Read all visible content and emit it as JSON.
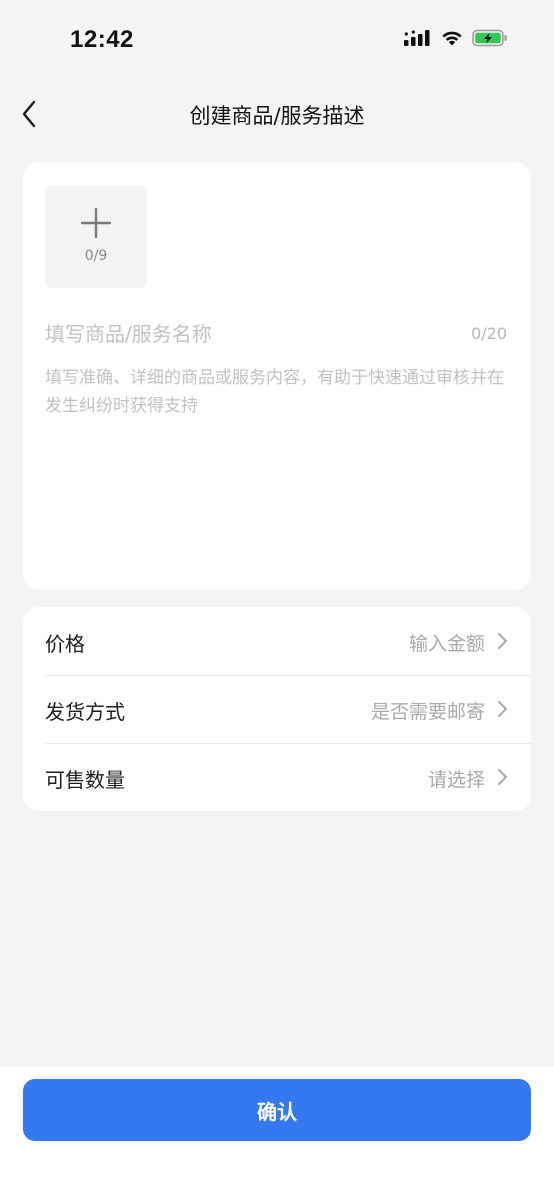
{
  "status_bar": {
    "time": "12:42"
  },
  "nav": {
    "title": "创建商品/服务描述"
  },
  "description_card": {
    "upload_count": "0/9",
    "name_placeholder": "填写商品/服务名称",
    "name_counter": "0/20",
    "desc_placeholder": "填写准确、详细的商品或服务内容，有助于快速通过审核并在发生纠纷时获得支持"
  },
  "options": [
    {
      "label": "价格",
      "value": "输入金额"
    },
    {
      "label": "发货方式",
      "value": "是否需要邮寄"
    },
    {
      "label": "可售数量",
      "value": "请选择"
    }
  ],
  "confirm": {
    "label": "确认"
  },
  "colors": {
    "accent": "#3478f0",
    "battery_green": "#34c759",
    "background": "#f4f4f5"
  }
}
